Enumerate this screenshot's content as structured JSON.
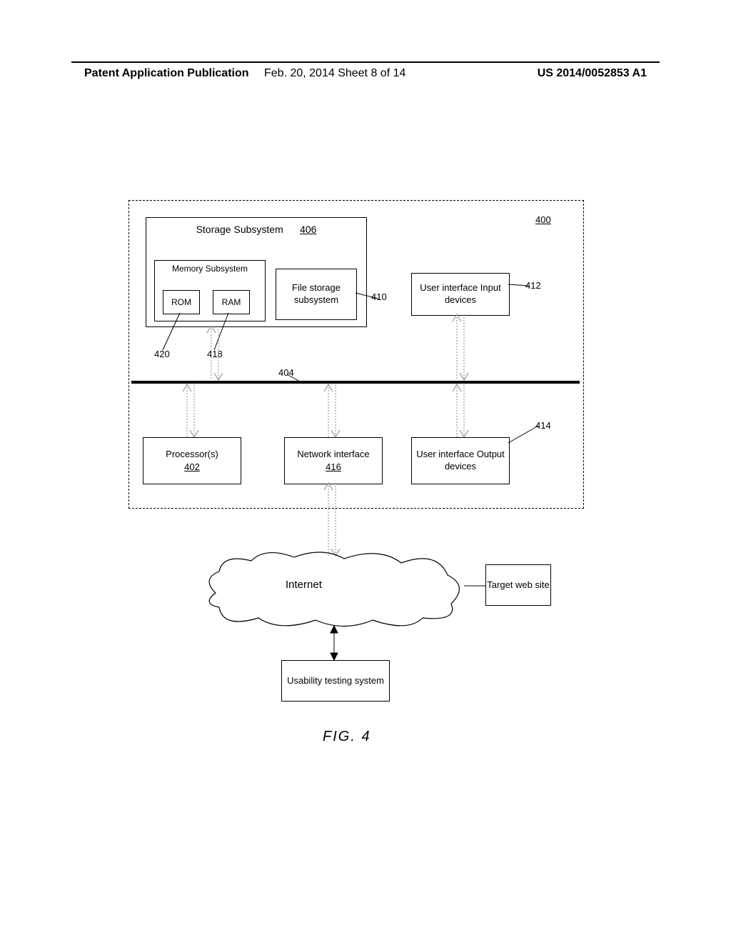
{
  "header": {
    "left": "Patent Application Publication",
    "center": "Feb. 20, 2014   Sheet 8 of 14",
    "right": "US 2014/0052853 A1"
  },
  "refs": {
    "r400": "400",
    "r402": "402",
    "r404": "404",
    "r406": "406",
    "r410": "410",
    "r412": "412",
    "r414": "414",
    "r416": "416",
    "r418": "418",
    "r420": "420"
  },
  "boxes": {
    "storage": "Storage Subsystem",
    "memory": "Memory Subsystem",
    "rom": "ROM",
    "ram": "RAM",
    "filestorage": "File storage subsystem",
    "uiinput": "User interface Input devices",
    "processors": "Processor(s)",
    "network": "Network interface",
    "uioutput": "User interface Output devices",
    "internet": "Internet",
    "target": "Target web site",
    "usability": "Usability testing system"
  },
  "figure": "FIG. 4"
}
